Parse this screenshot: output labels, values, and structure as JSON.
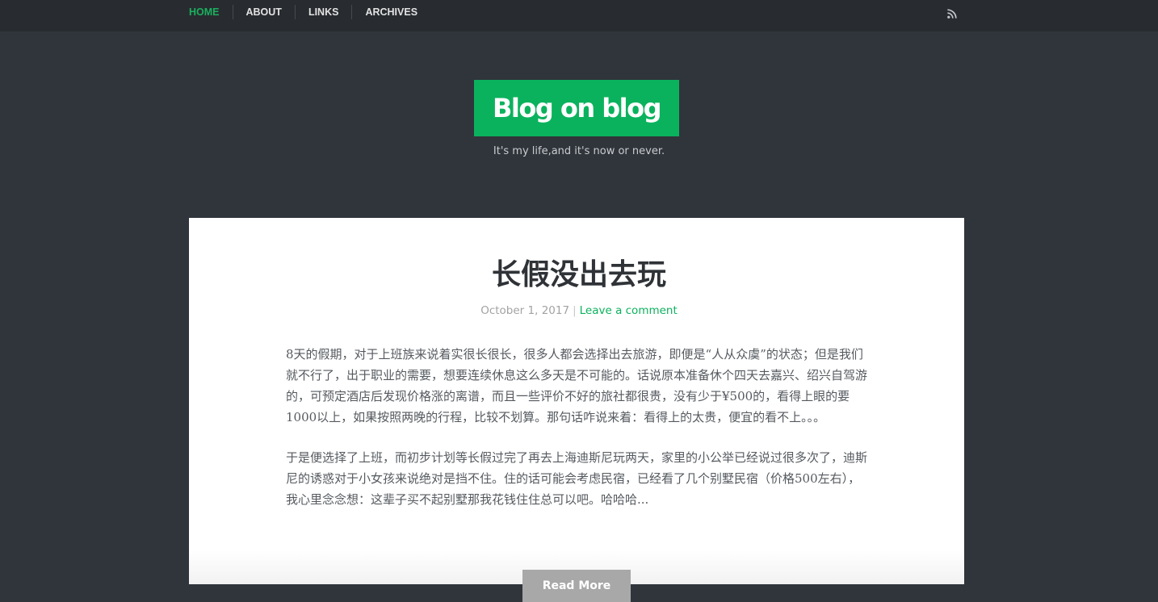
{
  "nav": {
    "items": [
      {
        "label": "HOME"
      },
      {
        "label": "ABOUT"
      },
      {
        "label": "LINKS"
      },
      {
        "label": "ARCHIVES"
      }
    ],
    "rss_icon": "rss-icon"
  },
  "site": {
    "title": "Blog on blog",
    "tagline": "It's my life,and it's now or never."
  },
  "post": {
    "title": "长假没出去玩",
    "date": "October 1, 2017",
    "separator": "|",
    "comment_link": "Leave a comment",
    "paragraphs": [
      "8天的假期，对于上班族来说着实很长很长，很多人都会选择出去旅游，即便是“人从众虞”的状态；但是我们就不行了，出于职业的需要，想要连续休息这么多天是不可能的。话说原本准备休个四天去嘉兴、绍兴自驾游的，可预定酒店后发现价格涨的离谱，而且一些评价不好的旅社都很贵，没有少于¥500的，看得上眼的要1000以上，如果按照两晚的行程，比较不划算。那句话咋说来着：看得上的太贵，便宜的看不上。。。",
      "于是便选择了上班，而初步计划等长假过完了再去上海迪斯尼玩两天，家里的小公举已经说过很多次了，迪斯尼的诱惑对于小女孩来说绝对是挡不住。住的话可能会考虑民宿，已经看了几个别墅民宿（价格500左右），我心里念念想：这辈子买不起别墅那我花钱住住总可以吧。哈哈哈..."
    ],
    "read_more": "Read More"
  },
  "colors": {
    "accent": "#0bb25d",
    "topbar": "#282c30",
    "background": "#30353b"
  }
}
